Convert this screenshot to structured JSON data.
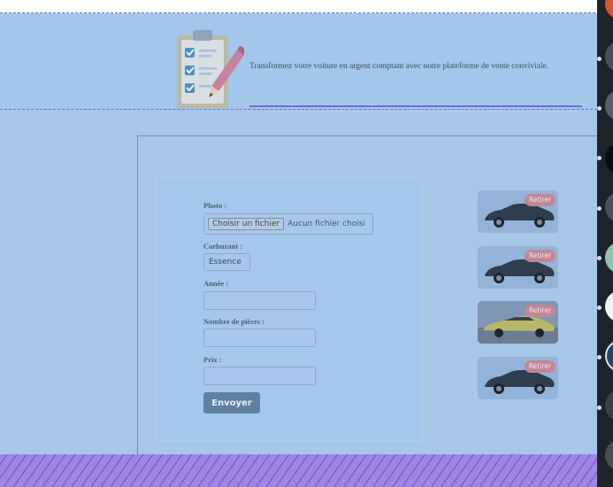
{
  "hero": {
    "tagline": "Transformez votre voiture en argent comptant avec notre plateforme de vente conviviale.",
    "icon": "clipboard-checklist-pencil-icon"
  },
  "form": {
    "photo_label": "Photo :",
    "file_button": "Choisir un fichier",
    "file_status": "Aucun fichier choisi",
    "fuel_label": "Carburant :",
    "fuel_value": "Essence",
    "year_label": "Année :",
    "year_value": "",
    "rooms_label": "Nombre de pièces :",
    "rooms_value": "",
    "price_label": "Prix :",
    "price_value": "",
    "submit_label": "Envoyer"
  },
  "thumbnails": [
    {
      "remove_label": "Retirer",
      "kind": "dark-sedan"
    },
    {
      "remove_label": "Retirer",
      "kind": "dark-sedan"
    },
    {
      "remove_label": "Retirer",
      "kind": "yellow-coupe"
    },
    {
      "remove_label": "Retirer",
      "kind": "dark-sedan"
    }
  ],
  "colors": {
    "overlay_blue": "#a3c6ea",
    "accent_purple": "#6c72d4",
    "submit_bg": "#5f7fa3",
    "remove_pill": "#c18796"
  }
}
